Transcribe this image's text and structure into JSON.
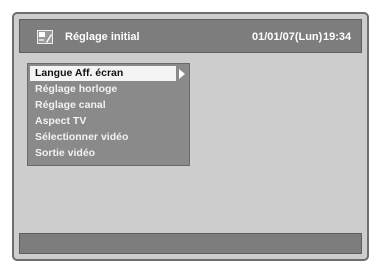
{
  "header": {
    "icon": "setup-menu-icon",
    "title": "Réglage initial",
    "date": "01/01/07(Lun)",
    "time": "19:34"
  },
  "menu": {
    "selected_index": 0,
    "submenu_indicator": "arrow-right-icon",
    "items": [
      {
        "label": "Langue Aff. écran"
      },
      {
        "label": "Réglage horloge"
      },
      {
        "label": "Réglage canal"
      },
      {
        "label": "Aspect TV"
      },
      {
        "label": "Sélectionner vidéo"
      },
      {
        "label": "Sortie vidéo"
      }
    ]
  },
  "footer": {
    "text": ""
  },
  "colors": {
    "panel_bg": "#cdcdcd",
    "bar_bg": "#7d7d7d",
    "menu_bg": "#8a8a8a",
    "highlight_bg": "#f4f4f4",
    "highlight_text": "#111111",
    "text_light": "#f2f2f2"
  }
}
